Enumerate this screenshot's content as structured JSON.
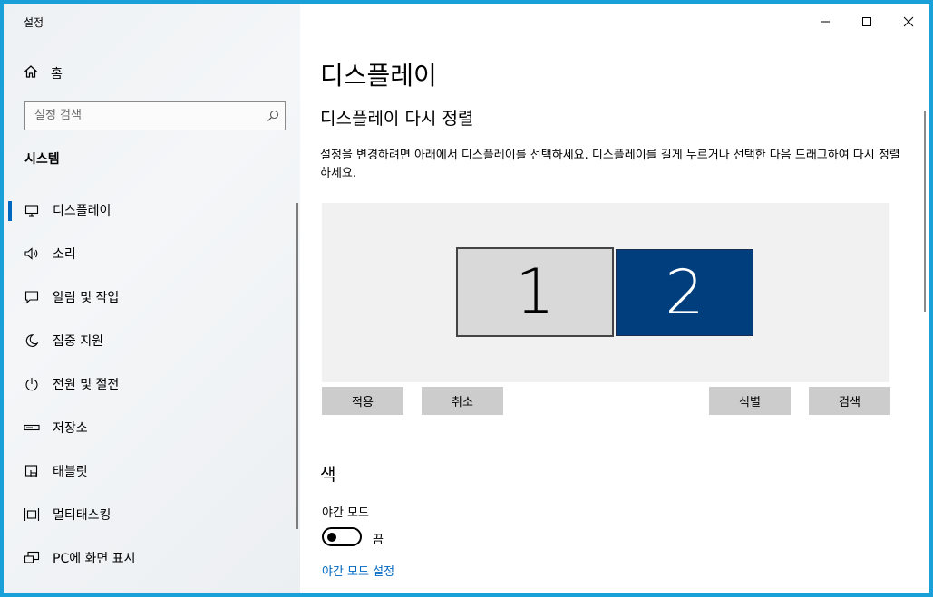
{
  "window": {
    "title": "설정"
  },
  "sidebar": {
    "home_label": "홈",
    "search_placeholder": "설정 검색",
    "section": "시스템",
    "items": [
      {
        "label": "디스플레이",
        "icon": "monitor-icon",
        "active": true
      },
      {
        "label": "소리",
        "icon": "speaker-icon"
      },
      {
        "label": "알림 및 작업",
        "icon": "notification-icon"
      },
      {
        "label": "집중 지원",
        "icon": "moon-icon"
      },
      {
        "label": "전원 및 절전",
        "icon": "power-icon"
      },
      {
        "label": "저장소",
        "icon": "storage-icon"
      },
      {
        "label": "태블릿",
        "icon": "tablet-icon"
      },
      {
        "label": "멀티태스킹",
        "icon": "multitasking-icon"
      },
      {
        "label": "PC에 화면 표시",
        "icon": "project-icon"
      }
    ]
  },
  "main": {
    "page_title": "디스플레이",
    "rearrange_title": "디스플레이 다시 정렬",
    "rearrange_desc": "설정을 변경하려면 아래에서 디스플레이를 선택하세요. 디스플레이를 길게 누르거나 선택한 다음 드래그하여 다시 정렬하세요.",
    "monitors": [
      {
        "number": "1",
        "selected": false
      },
      {
        "number": "2",
        "selected": true
      }
    ],
    "buttons": {
      "apply": "적용",
      "cancel": "취소",
      "identify": "식별",
      "detect": "검색"
    },
    "color_section": "색",
    "night_mode_label": "야간 모드",
    "night_mode_state": "끔",
    "night_mode_link": "야간 모드 설정"
  },
  "colors": {
    "accent": "#0067c0",
    "monitor_selected": "#003e7e",
    "monitor_unselected": "#d9d9d9",
    "desktop": "#1aa0d8"
  }
}
